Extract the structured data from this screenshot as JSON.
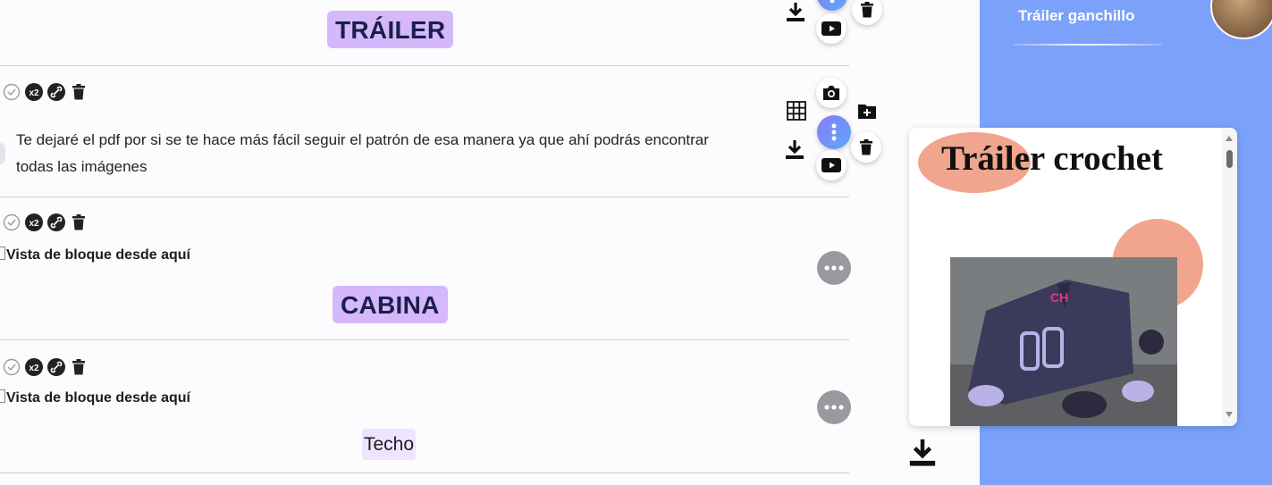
{
  "sections": {
    "trailer_heading": "TRÁILER",
    "cabina_heading": "CABINA",
    "techo_subheading": "Techo"
  },
  "content": {
    "paragraph": "Te dejaré el pdf por si se te hace más fácil seguir el patrón de esa manera ya que ahí podrás encontrar todas las imágenes",
    "block_view_1": "Vista de bloque desde aquí",
    "block_view_2": "Vista de bloque desde aquí"
  },
  "sidebar": {
    "title": "Tráiler ganchillo"
  },
  "preview_card": {
    "title": "Tráiler crochet"
  },
  "icons": {
    "row_tools": [
      "check-circle-icon",
      "x2-icon",
      "link-icon",
      "trash-icon"
    ],
    "fab_menu": [
      "grid-icon",
      "camera-icon",
      "add-folder-icon",
      "download-icon",
      "more-vertical-icon",
      "trash-icon",
      "youtube-icon"
    ],
    "more": "more-horizontal-icon"
  },
  "colors": {
    "heading_bg": "#d4b8fb",
    "subheading_bg": "#eee4ff",
    "sidebar_bg": "#7ba1fb",
    "accent_gradient_start": "#8a7bfb",
    "accent_gradient_end": "#5ba8f7",
    "blob": "#f1a48e"
  }
}
